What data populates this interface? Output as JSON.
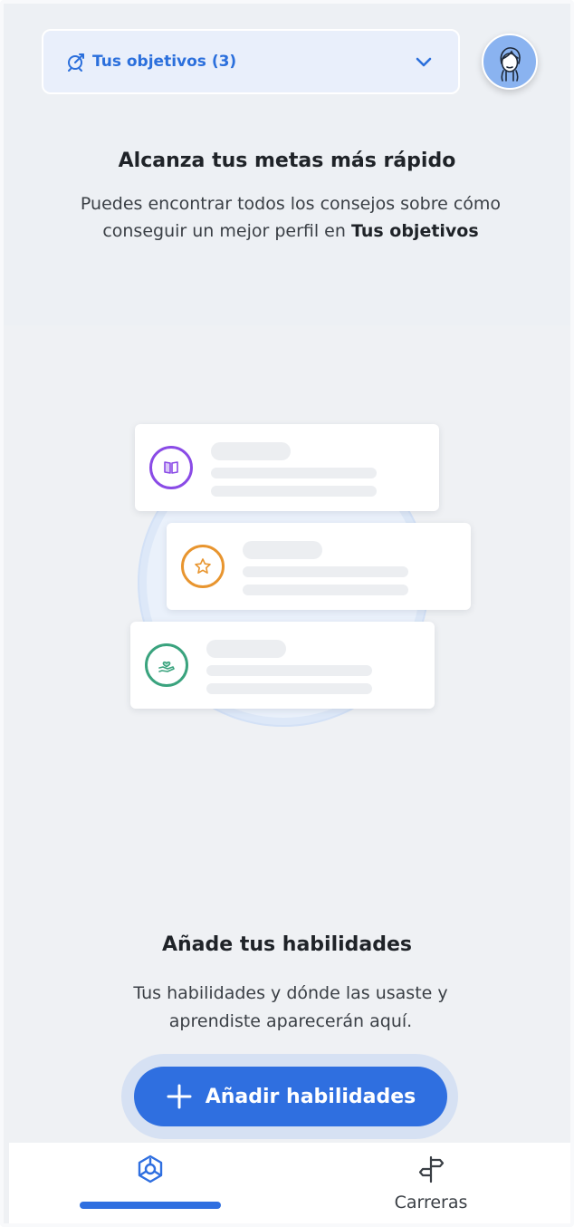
{
  "header": {
    "goals_dropdown_label": "Tus objetivos (3)",
    "goal_icon": "target-arrow-icon",
    "chevron_icon": "chevron-down-icon",
    "avatar_icon": "user-avatar-icon"
  },
  "intro": {
    "title": "Alcanza tus metas más rápido",
    "text_part1": "Puedes encontrar todos los consejos sobre cómo conseguir un mejor perfil en ",
    "text_bold": "Tus objetivos"
  },
  "illustration": {
    "cards": [
      {
        "icon": "book-icon",
        "color": "#8a4be6"
      },
      {
        "icon": "star-icon",
        "color": "#e8952f"
      },
      {
        "icon": "hand-heart-icon",
        "color": "#3aa37e"
      }
    ]
  },
  "skills": {
    "title": "Añade tus habilidades",
    "text": "Tus habilidades y dónde las usaste y aprendiste aparecerán aquí.",
    "add_button_label": "Añadir habilidades"
  },
  "bottom_nav": {
    "items": [
      {
        "label": "",
        "icon": "hub-icon",
        "active": true
      },
      {
        "label": "Carreras",
        "icon": "signpost-icon",
        "active": false
      }
    ]
  },
  "colors": {
    "accent": "#2f6fe0",
    "background": "#eff1f4"
  }
}
